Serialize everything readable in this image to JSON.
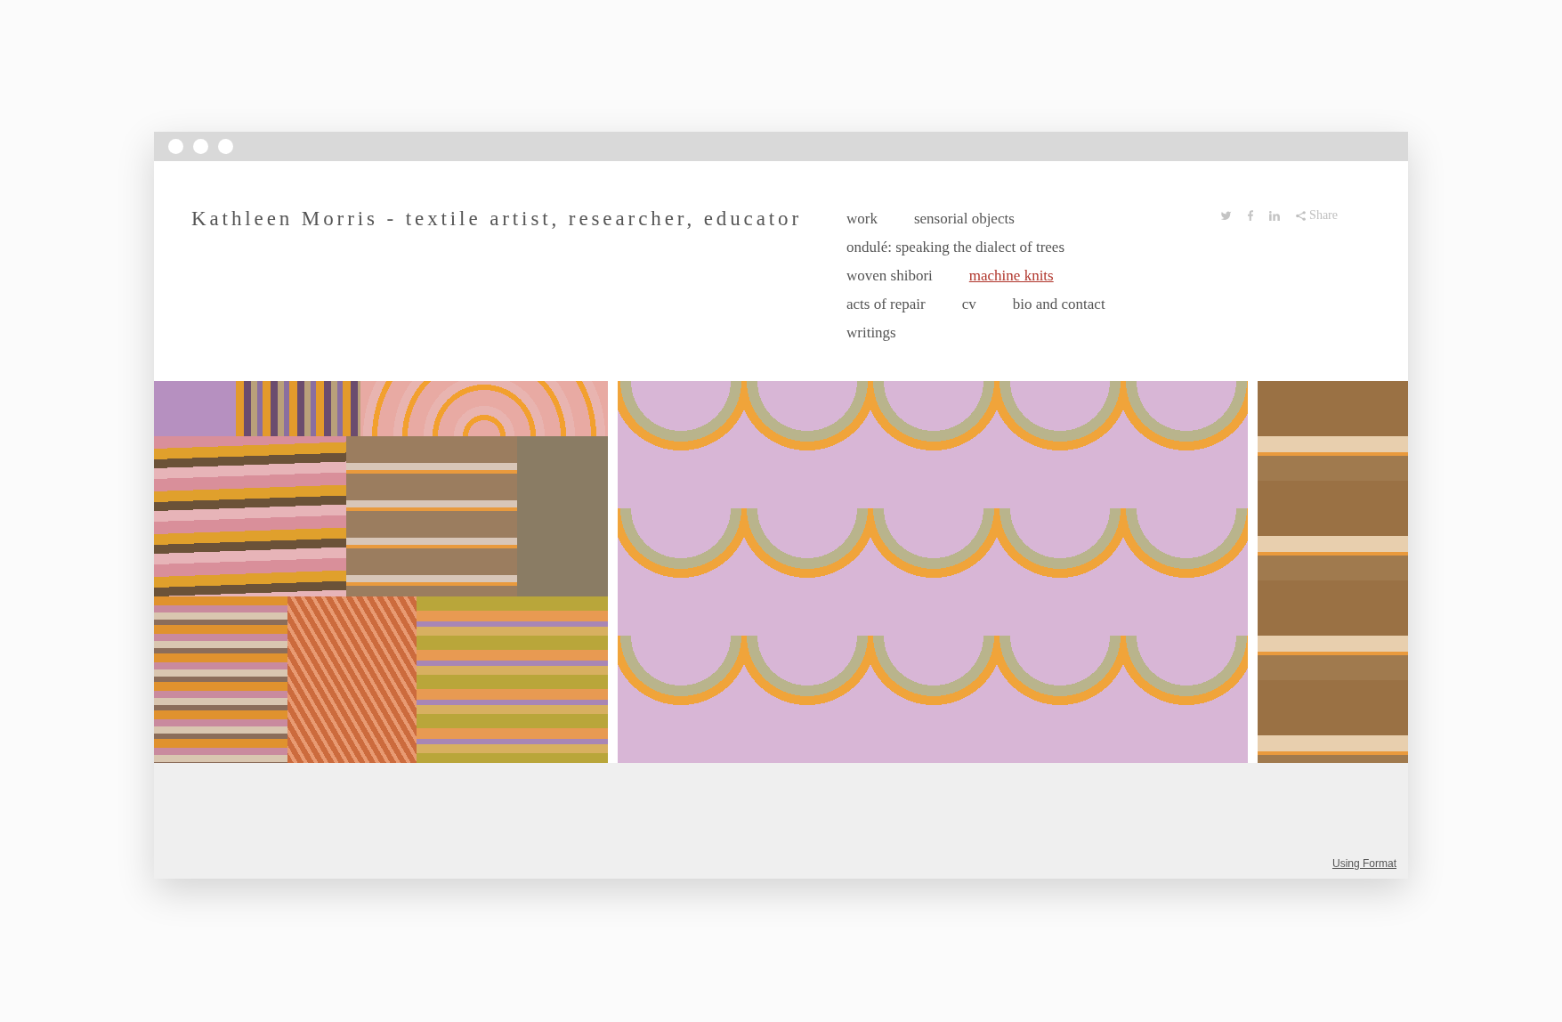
{
  "site": {
    "title": "Kathleen Morris - textile artist, researcher, educator"
  },
  "nav": {
    "rows": [
      {
        "items": [
          {
            "label": "work",
            "selected": false
          },
          {
            "label": "sensorial objects",
            "selected": false
          }
        ]
      },
      {
        "items": [
          {
            "label": "ondulé: speaking the dialect of trees",
            "selected": false
          }
        ]
      },
      {
        "items": [
          {
            "label": "woven shibori",
            "selected": false
          },
          {
            "label": "machine knits",
            "selected": true
          }
        ]
      },
      {
        "items": [
          {
            "label": "acts of repair",
            "selected": false
          },
          {
            "label": "cv",
            "selected": false
          },
          {
            "label": "bio and contact",
            "selected": false
          }
        ]
      },
      {
        "items": [
          {
            "label": "writings",
            "selected": false
          }
        ]
      }
    ]
  },
  "share": {
    "label": "Share"
  },
  "footer": {
    "link": "Using Format"
  }
}
